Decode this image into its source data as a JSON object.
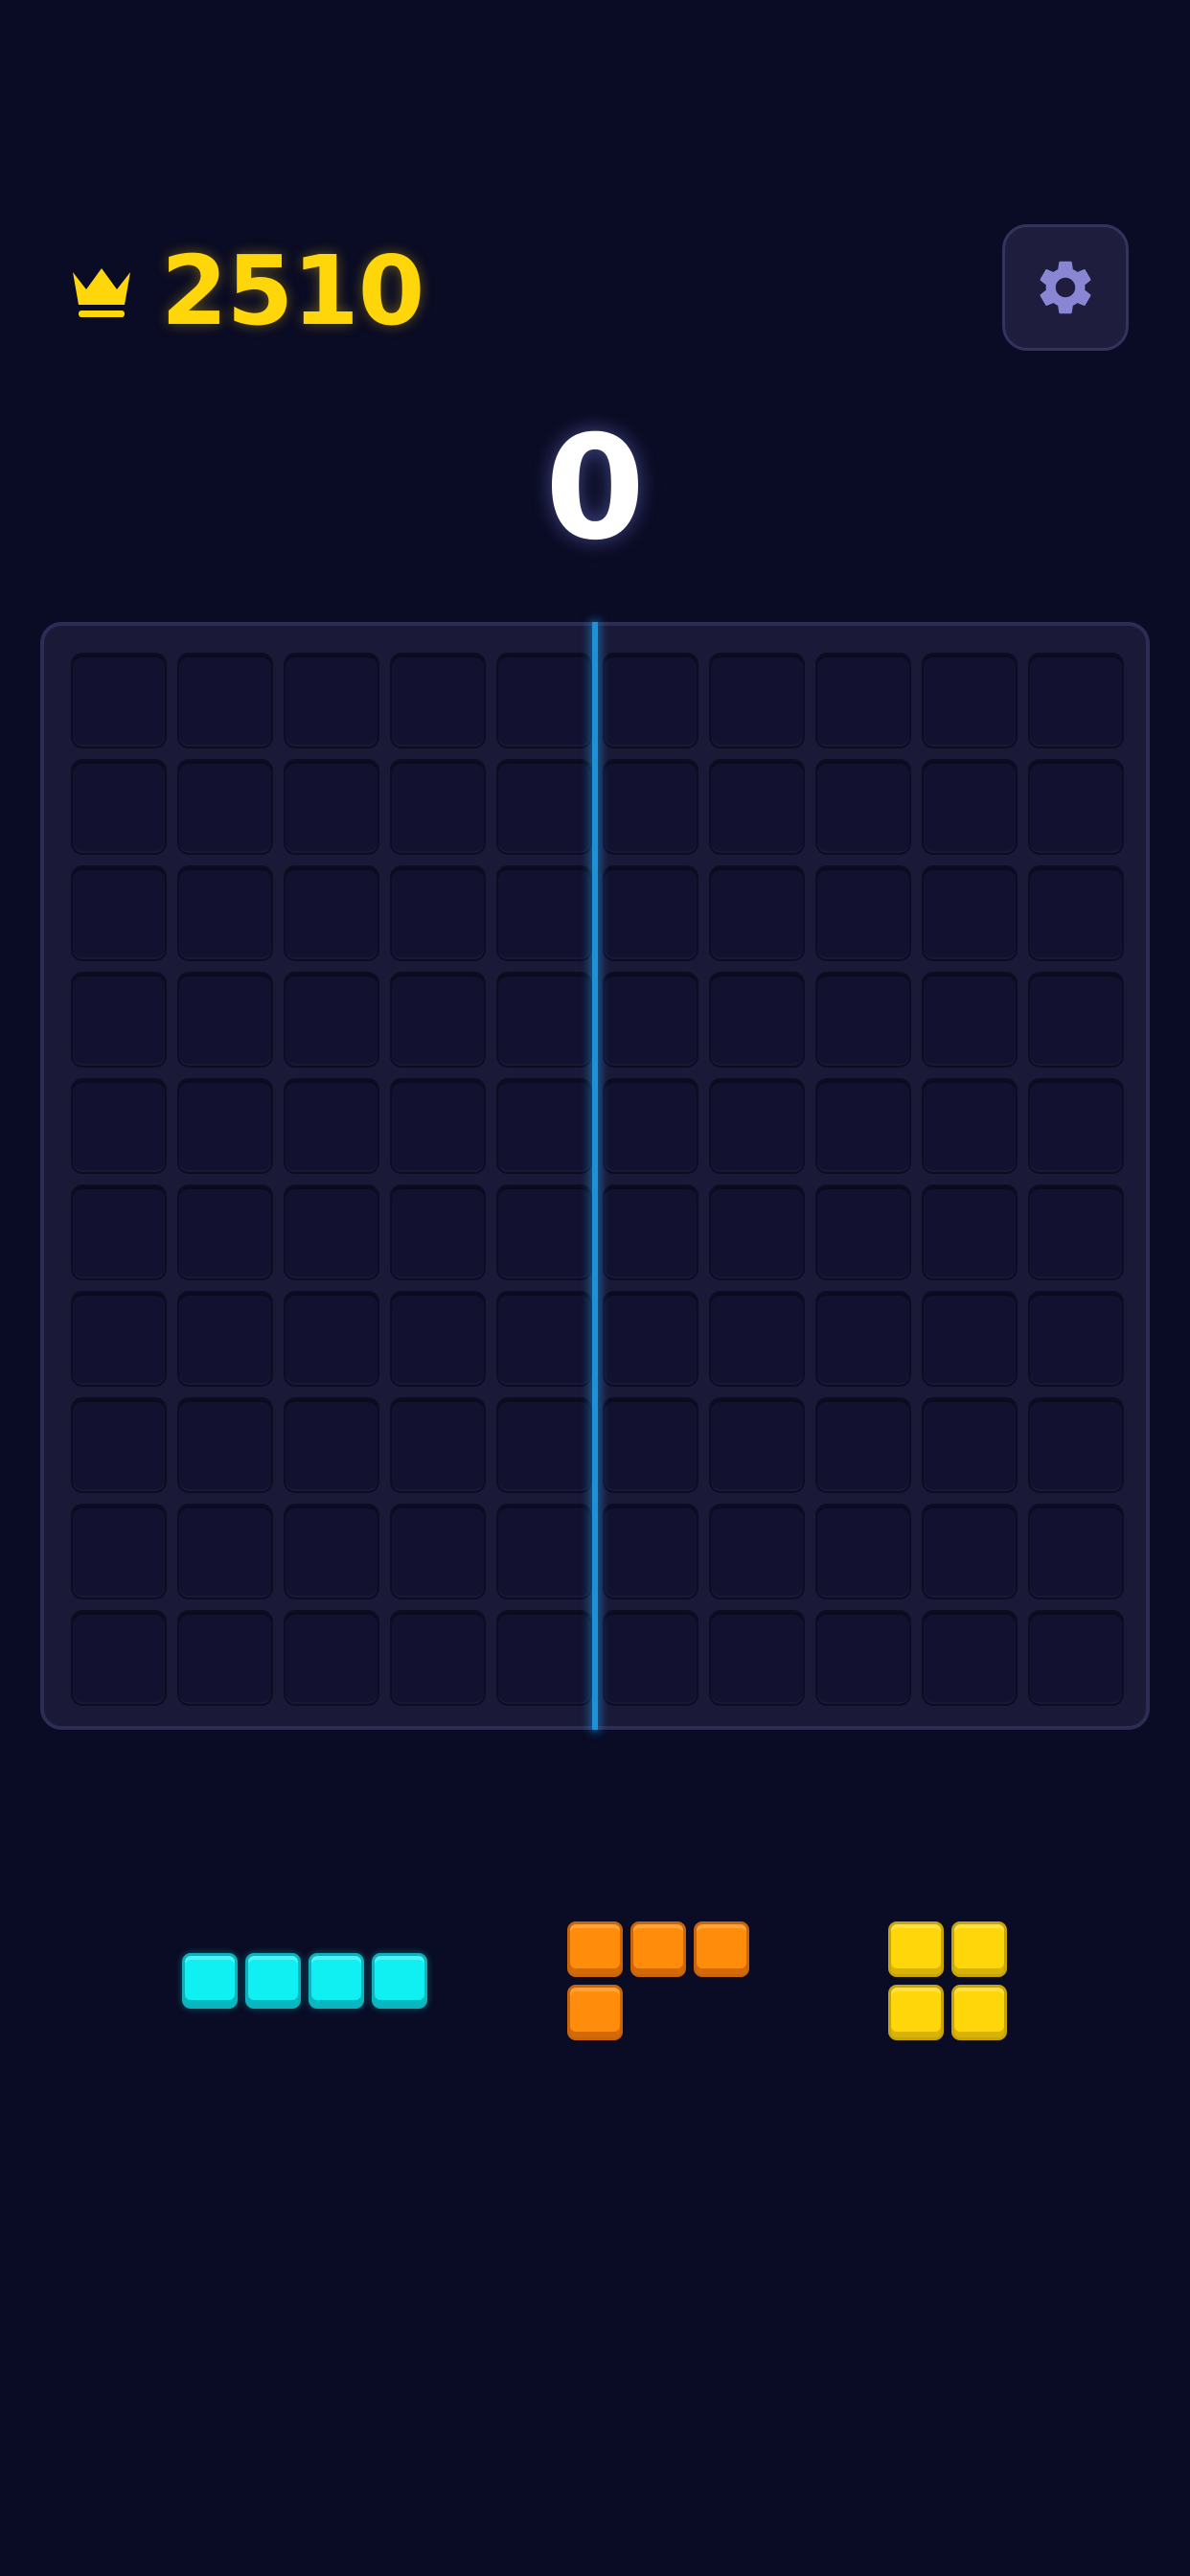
{
  "header": {
    "best_score": "2510",
    "best_icon": "crown-icon",
    "settings_icon": "gear-icon"
  },
  "score": {
    "current": "0"
  },
  "board": {
    "rows": 10,
    "cols": 10,
    "filled_cells": 0
  },
  "tray": {
    "pieces": [
      {
        "shape": "I-horizontal-4",
        "color": "#10f0f2",
        "color_name": "cyan"
      },
      {
        "shape": "L-3x2",
        "color": "#ff8c0a",
        "color_name": "orange"
      },
      {
        "shape": "square-2x2",
        "color": "#ffd60a",
        "color_name": "yellow"
      }
    ]
  },
  "colors": {
    "background": "#0a0b24",
    "board": "#1a1a38",
    "cell": "#121230",
    "accent_line": "#1e90d6",
    "best_score": "#ffd60a",
    "settings_icon": "#8b86d4"
  }
}
